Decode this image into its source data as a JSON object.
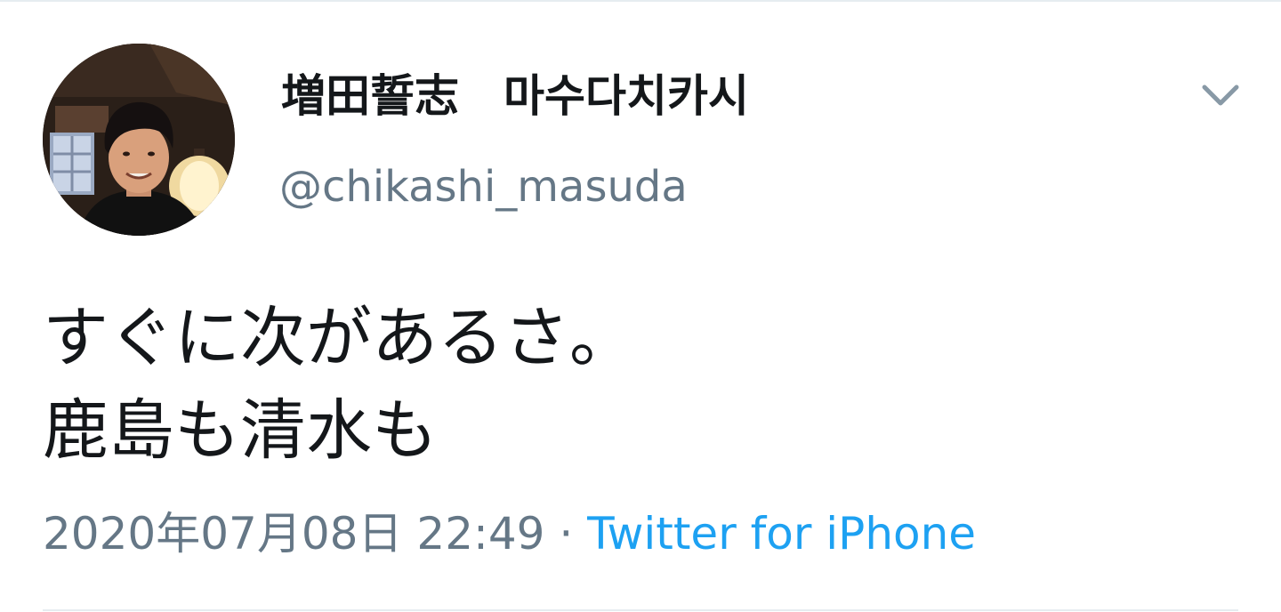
{
  "tweet": {
    "author": {
      "display_name": "増田誓志　마수다치카시",
      "handle": "@chikashi_masuda",
      "avatar_icon": "user-photo-avatar"
    },
    "menu_icon": "chevron-down-icon",
    "text_lines": [
      "すぐに次があるさ。",
      "鹿島も清水も"
    ],
    "timestamp": "2020年07月08日 22:49",
    "separator": " · ",
    "source": "Twitter for iPhone"
  },
  "colors": {
    "text_primary": "#14171a",
    "text_secondary": "#657786",
    "link": "#1da1f2",
    "divider": "#e6ecf0"
  }
}
